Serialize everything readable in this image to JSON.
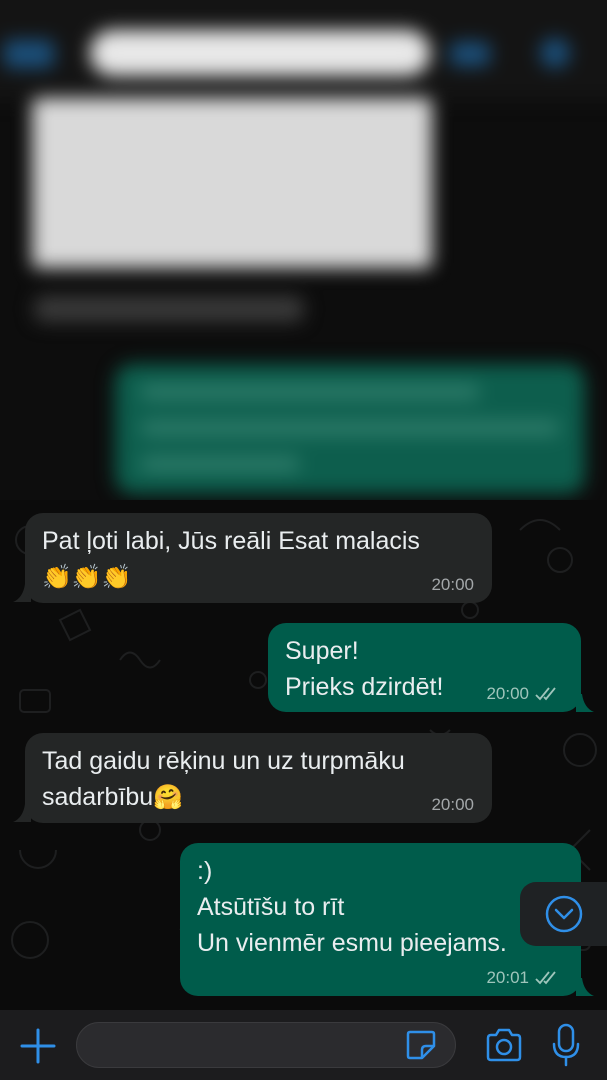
{
  "messages": [
    {
      "direction": "incoming",
      "line1": "Pat ļoti labi, Jūs reāli Esat malacis",
      "emoji": "👏👏👏",
      "time": "20:00"
    },
    {
      "direction": "outgoing",
      "line1": "Super!",
      "line2": "Prieks dzirdēt!",
      "time": "20:00",
      "status": "read"
    },
    {
      "direction": "incoming",
      "line1": "Tad gaidu rēķinu un uz turpmāku",
      "line2": "sadarbību",
      "emoji": "🤗",
      "time": "20:00"
    },
    {
      "direction": "outgoing",
      "line1": ":)",
      "line2": "Atsūtīšu to rīt",
      "line3": "Un vienmēr esmu pieejams.",
      "time": "20:01",
      "status": "read"
    }
  ],
  "input": {
    "placeholder": "",
    "value": ""
  },
  "icons": {
    "attach": "plus-icon",
    "sticker": "sticker-icon",
    "camera": "camera-icon",
    "mic": "microphone-icon",
    "scroll": "chevron-down-circle-icon"
  },
  "colors": {
    "accent": "#2f8fe8",
    "incoming_bubble": "#242626",
    "outgoing_bubble": "#005c4b",
    "background": "#0b0b0b"
  }
}
